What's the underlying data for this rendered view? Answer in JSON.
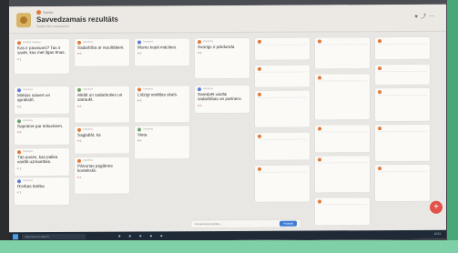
{
  "header": {
    "owner": "Sanita",
    "title": "Savvedzamais rezultāts",
    "subtitle": "Padlet bez nosaukuma",
    "icons": [
      "like-icon",
      "share-icon",
      "more-icon"
    ]
  },
  "cards": [
    {
      "author": "Kristīne Kalniņa",
      "text": "Kas ir pavasaris? Tas ir saule, kas met ilgas ēnas.",
      "rx": "1",
      "c": "o"
    },
    {
      "author": "Anonīms",
      "text": "Mirkļus satvert un aprakstīt.",
      "rx": "0",
      "c": "b"
    },
    {
      "author": "Anonīms",
      "text": "Sapratne par teikumiem.",
      "rx": "0",
      "c": "g"
    },
    {
      "author": "Anonīms",
      "text": "Tās puses, kas palika vairāk uzmanības.",
      "rx": "1",
      "c": "o"
    },
    {
      "author": "Anonīms",
      "text": "Rīcības būtība",
      "rx": "1",
      "c": "b"
    },
    {
      "author": "Anonīms",
      "text": "Sadarbība ar rezultātiem.",
      "rx": "0",
      "c": "o"
    },
    {
      "author": "Anonīms",
      "text": "Atklāt un sadarboties un satraukt.",
      "rx": "0",
      "c": "g"
    },
    {
      "author": "Anonīms",
      "text": "Saglabāt, ka",
      "rx": "0",
      "c": "o"
    },
    {
      "author": "Anonīms",
      "text": "Pārrunas pagātnes kontekstā.",
      "rx": "1",
      "c": "o"
    },
    {
      "author": "Anonīms",
      "text": "Mums kopā mācīties.",
      "rx": "0",
      "c": "b"
    },
    {
      "author": "Anonīms",
      "text": "Līdzīgi nedēļas skats.",
      "rx": "0",
      "c": "o"
    },
    {
      "author": "Anonīms",
      "text": "Vieta",
      "rx": "0",
      "c": "g"
    },
    {
      "author": "Anonīms",
      "text": "Svarīgs ir pārdomāt.",
      "rx": "0",
      "c": "o"
    },
    {
      "author": "Anonīms",
      "text": "Saredzēt vairāk sadarbības un partneru.",
      "rx": "0",
      "c": "b"
    }
  ],
  "bottom_bar": {
    "placeholder": "Pievienot komentāru...",
    "button": "Publicēt"
  },
  "fab": "+",
  "taskbar": {
    "search": "Type here to search",
    "clock": "12:34"
  }
}
